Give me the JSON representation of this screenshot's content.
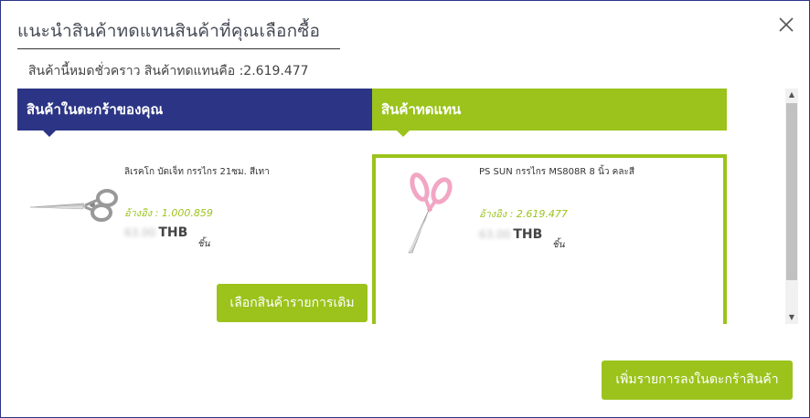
{
  "modal": {
    "title": "แนะนำสินค้าทดแทนสินค้าที่คุณเลือกซื้อ",
    "subtitle": "สินค้านี้หมดชั่วคราว สินค้าทดแทนคือ :2.619.477"
  },
  "columns": {
    "left_header": "สินค้าในตะกร้าของคุณ",
    "right_header": "สินค้าทดแทน"
  },
  "original_product": {
    "name": "ลิเรคโก บัดเจ็ท กรรไกร 21ซม. สีเทา",
    "reference": "อ้างอิง : 1.000.859",
    "price": "63.00",
    "currency": "THB",
    "unit": "ชิ้น",
    "select_button": "เลือกสินค้ารายการเดิม"
  },
  "replacement_product": {
    "name": "PS SUN กรรไกร MS808R 8 นิ้ว คละสี",
    "reference": "อ้างอิง : 2.619.477",
    "price": "63.00",
    "currency": "THB",
    "unit": "ชิ้น"
  },
  "footer": {
    "add_to_cart_button": "เพิ่มรายการลงในตะกร้าสินค้า"
  },
  "colors": {
    "primary_blue": "#2c3585",
    "accent_green": "#9bc31c"
  }
}
